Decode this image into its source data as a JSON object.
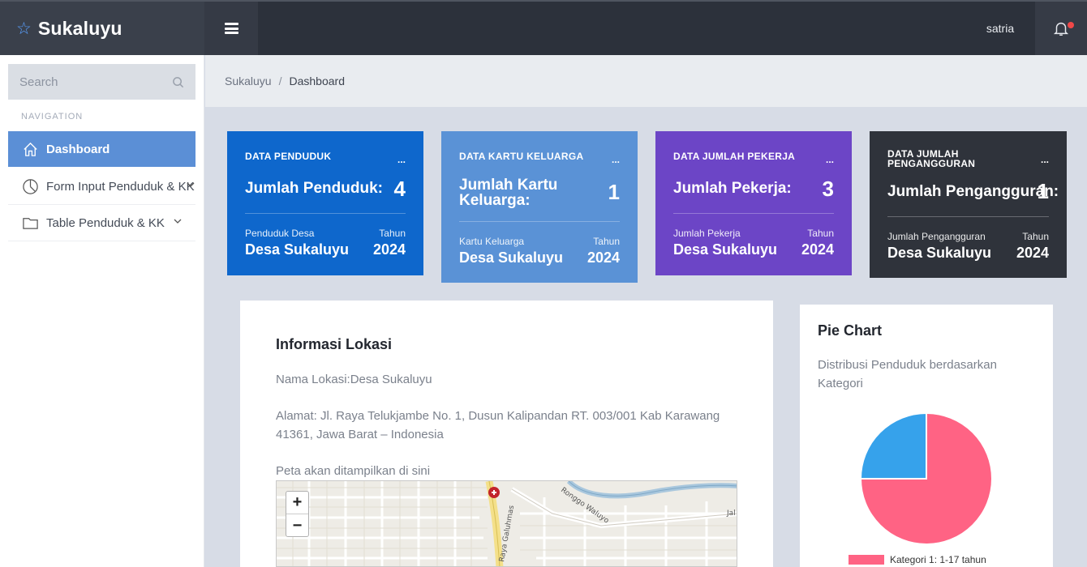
{
  "header": {
    "brand": "Sukaluyu",
    "brand_icon": "star-icon",
    "user": "satria",
    "notification_icon": "bell-icon"
  },
  "sidebar": {
    "search_placeholder": "Search",
    "nav_label": "NAVIGATION",
    "items": [
      {
        "label": "Dashboard",
        "icon": "home-icon",
        "active": true
      },
      {
        "label": "Form Input Penduduk & KK",
        "icon": "pie-icon",
        "has_submenu": true
      },
      {
        "label": "Table Penduduk & KK",
        "icon": "folder-icon",
        "has_submenu": true
      }
    ]
  },
  "breadcrumb": {
    "root": "Sukaluyu",
    "separator": "/",
    "current": "Dashboard"
  },
  "cards": [
    {
      "title": "DATA PENDUDUK",
      "menu": "...",
      "label": "Jumlah Penduduk:",
      "value": "4",
      "sub_left": "Penduduk Desa",
      "sub_right": "Tahun",
      "big_left": "Desa Sukaluyu",
      "big_right": "2024",
      "color": "#0e67cc"
    },
    {
      "title": "DATA KARTU KELUARGA",
      "menu": "...",
      "label": "Jumlah Kartu Keluarga:",
      "value": "1",
      "sub_left": "Kartu Keluarga",
      "sub_right": "Tahun",
      "big_left": "Desa Sukaluyu",
      "big_right": "2024",
      "color": "#5a92d6"
    },
    {
      "title": "DATA JUMLAH PEKERJA",
      "menu": "...",
      "label": "Jumlah Pekerja:",
      "value": "3",
      "sub_left": "Jumlah Pekerja",
      "sub_right": "Tahun",
      "big_left": "Desa Sukaluyu",
      "big_right": "2024",
      "color": "#6c45c6"
    },
    {
      "title": "DATA JUMLAH PENGANGGURAN",
      "menu": "...",
      "label": "Jumlah Pengangguran:",
      "value": "1",
      "sub_left": "Jumlah Pengangguran",
      "sub_right": "Tahun",
      "big_left": "Desa Sukaluyu",
      "big_right": "2024",
      "color": "#2f333b"
    }
  ],
  "info": {
    "title": "Informasi Lokasi",
    "name_line": "Nama Lokasi:Desa Sukaluyu",
    "address_line": "Alamat: Jl. Raya Telukjambe No. 1, Dusun Kalipandan RT. 003/001 Kab Karawang 41361, Jawa Barat – Indonesia",
    "map_caption": "Peta akan ditampilkan di sini",
    "zoom_in": "+",
    "zoom_out": "−",
    "map_labels": {
      "road1": "Raya Galuhmas",
      "road2": "Ronggo Waluyo",
      "road3": "Jal"
    }
  },
  "pie": {
    "title": "Pie Chart",
    "subtitle": "Distribusi Penduduk berdasarkan Kategori",
    "legend_first": "Kategori 1: 1-17 tahun"
  },
  "chart_data": {
    "type": "pie",
    "values": [
      3,
      1
    ],
    "labels": [
      "Kategori 1: 1-17 tahun",
      ""
    ],
    "colors": [
      "#ff6384",
      "#36a2eb"
    ]
  }
}
